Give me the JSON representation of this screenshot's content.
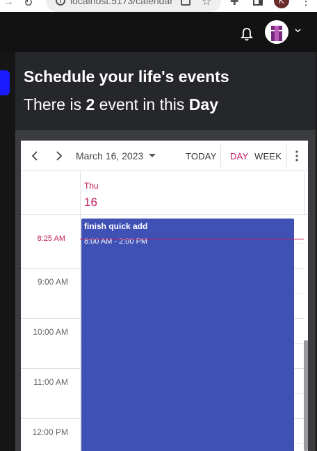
{
  "browser": {
    "url": "localhost:5173/calendar",
    "profile_initial": "K"
  },
  "hero": {
    "title": "Schedule your life's events",
    "sub_prefix": "There is ",
    "count": "2",
    "sub_middle": " event in this ",
    "period": "Day"
  },
  "calendar": {
    "date_label": "March 16, 2023",
    "today_label": "TODAY",
    "day_label": "DAY",
    "week_label": "WEEK",
    "day_of_week": "Thu",
    "day_number": "16",
    "now_label": "8:25 AM",
    "hours": [
      "9:00 AM",
      "10:00 AM",
      "11:00 AM",
      "12:00 PM"
    ],
    "event": {
      "title": "finish quick add",
      "time": "8:00 AM - 2:00 PM"
    }
  },
  "colors": {
    "accent": "#c2185b",
    "event": "#3f51b5",
    "app_background": "#121212"
  },
  "icons": [
    "forward-icon",
    "reload-icon",
    "info-icon",
    "share-icon",
    "star-icon",
    "extensions-icon",
    "side-panel-icon",
    "more-vert-icon",
    "bell-icon",
    "chevron-down-icon",
    "chevron-left-icon",
    "chevron-right-icon",
    "dropdown-caret-icon"
  ]
}
